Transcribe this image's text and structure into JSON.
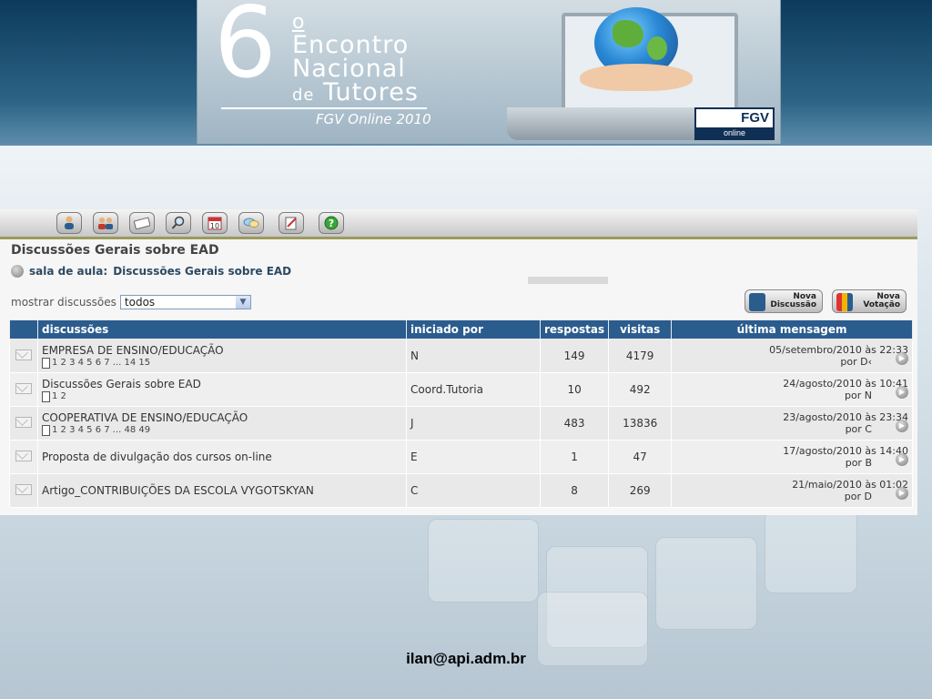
{
  "banner": {
    "number": "6",
    "ordinal": "o",
    "line1": "Encontro",
    "line2": "Nacional",
    "line3_prefix": "de",
    "line3_main": "Tutores",
    "subtitle": "FGV Online 2010",
    "logo_text": "FGV",
    "logo_sub": "online"
  },
  "toolbar": {
    "icons": [
      "user-icon",
      "group-icon",
      "message-icon",
      "search-icon",
      "calendar-icon",
      "chat-icon",
      "edit-icon",
      "help-icon"
    ],
    "calendar_text": "10",
    "help_text": "?"
  },
  "page": {
    "title": "Discussões Gerais sobre EAD",
    "breadcrumb_prefix": "sala de aula:",
    "breadcrumb_link": "Discussões Gerais sobre EAD",
    "filter_label": "mostrar discussões",
    "filter_value": "todos",
    "new_discussion_1": "Nova",
    "new_discussion_2": "Discussão",
    "new_vote_1": "Nova",
    "new_vote_2": "Votação"
  },
  "table": {
    "headers": {
      "discussions": "discussões",
      "started_by": "iniciado por",
      "replies": "respostas",
      "visits": "visitas",
      "last": "última mensagem"
    },
    "rows": [
      {
        "title": "EMPRESA DE ENSINO/EDUCAÇÃO",
        "pages": "1 2 3 4 5 6 7 ... 14 15",
        "author": "N",
        "replies": "149",
        "visits": "4179",
        "date": "05/setembro/2010 às 22:33",
        "by": "por D‹"
      },
      {
        "title": "Discussões Gerais sobre EAD",
        "pages": "1 2",
        "author": "Coord.Tutoria",
        "replies": "10",
        "visits": "492",
        "date": "24/agosto/2010 às 10:41",
        "by": "por N"
      },
      {
        "title": "COOPERATIVA DE ENSINO/EDUCAÇÃO",
        "pages": "1 2 3 4 5 6 7 ... 48 49",
        "author": "J",
        "replies": "483",
        "visits": "13836",
        "date": "23/agosto/2010 às 23:34",
        "by": "por C"
      },
      {
        "title": "Proposta de divulgação dos cursos on-line",
        "pages": "",
        "author": "E",
        "replies": "1",
        "visits": "47",
        "date": "17/agosto/2010 às 14:40",
        "by": "por B"
      },
      {
        "title": "Artigo_CONTRIBUIÇÕES DA ESCOLA VYGOTSKYAN",
        "pages": "",
        "author": "C",
        "replies": "8",
        "visits": "269",
        "date": "21/maio/2010 às 01:02",
        "by": "por D"
      }
    ]
  },
  "footer": {
    "email": "ilan@api.adm.br"
  },
  "colors": {
    "header_bg": "#2b5c8e",
    "link": "#2c4a63"
  }
}
